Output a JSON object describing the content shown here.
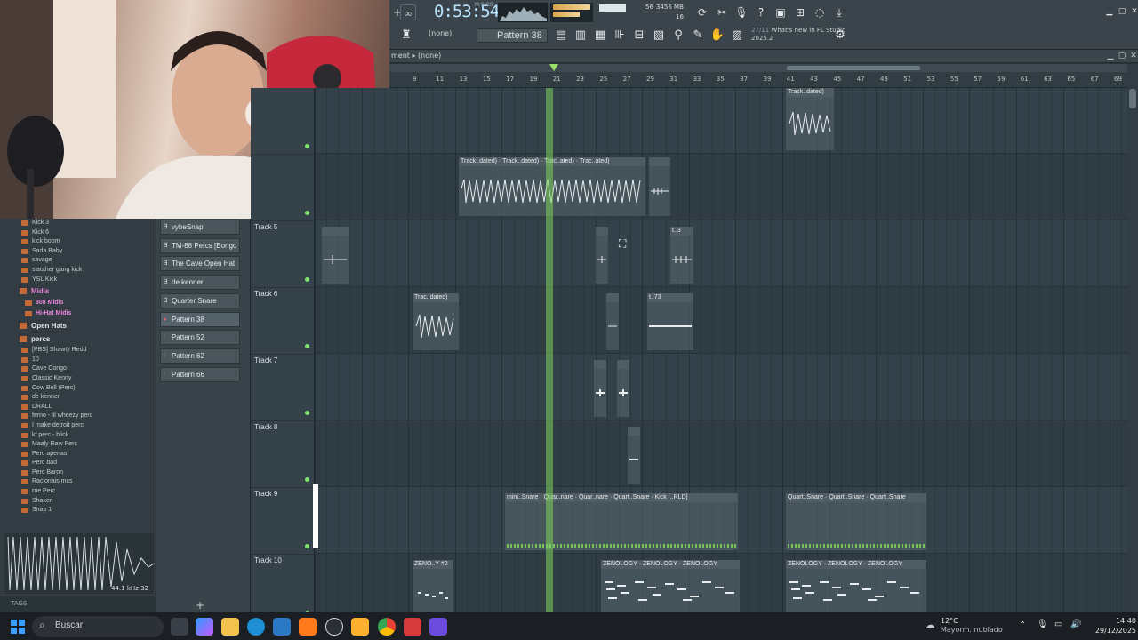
{
  "toolbar": {
    "time": "0:53:54",
    "time_unit": "M:S:CS",
    "memory_total": "3456 MB",
    "memory_value": "56",
    "polyphony": "16",
    "pattern_label": "Pattern 38",
    "none_label": "(none)",
    "news_date": "27/11",
    "news_text": "What's new in FL Studio 2025.2"
  },
  "playlist": {
    "title_prefix": "ment",
    "title_arrangement": "(none)",
    "ruler_ticks": [
      "9",
      "11",
      "13",
      "15",
      "17",
      "19",
      "21",
      "23",
      "25",
      "27",
      "29",
      "31",
      "33",
      "35",
      "37",
      "39",
      "41",
      "43",
      "45",
      "47",
      "49",
      "51",
      "53",
      "55",
      "57",
      "59",
      "61",
      "63",
      "65",
      "67",
      "69"
    ]
  },
  "browser": {
    "items_top": [
      "Kick 3",
      "Kick 6",
      "kick boom",
      "Sada Baby",
      "savage",
      "slauther gang kick",
      "YSL Kick"
    ],
    "folder_midis": "Midis",
    "sub_808": "808 Midis",
    "sub_hihat": "Hi-Hat Midis",
    "folder_open_hats": "Open Hats",
    "folder_percs": "percs",
    "items_percs": [
      "[PBS] Shawty Redd",
      "10",
      "Cave Congo",
      "Classic Kenny",
      "Cow Bell (Perc)",
      "de kenner",
      "DRALL",
      "ferno - lil wheezy perc",
      "I make detroit perc",
      "kf perc - blick",
      "Maaly Raw Perc",
      "Perc apenas",
      "Perc bad",
      "Perc Baron",
      "Racionais mcs",
      "rne Perc",
      "Shaker",
      "Snap 1"
    ],
    "sample_info": "44.1 kHz 32",
    "tags_label": "TAGS"
  },
  "patterns": [
    "vybeSnap",
    "TM-88 Percs [Bongo 1]",
    "The Cave Open Hat",
    "de kenner",
    "Quarter Snare",
    "Pattern 38",
    "Pattern 52",
    "Pattern 62",
    "Pattern 66"
  ],
  "tracks": [
    "Track 5",
    "Track 6",
    "Track 7",
    "Track 8",
    "Track 9",
    "Track 10"
  ],
  "clips": {
    "c1": "Track..dated)",
    "c2": "Track..dated)",
    "c3": "Track..dated)",
    "c4": "Trac..ated)",
    "c5": "Trac..ated)",
    "c6": "Trac..dated)",
    "c7": "t..3",
    "c8": "t..73",
    "c9": "mini..Snare",
    "c10": "Quar..nare",
    "c11": "Quar..nare",
    "c12": "Quart..Snare",
    "c13": "Kick [..RLD]",
    "c14": "Quart..Snare",
    "c15": "Quart..Snare",
    "c16": "Quart..Snare",
    "c17": "ZENO..Y #2",
    "c18": "ZENOLOGY",
    "c19": "ZENOLOGY",
    "c20": "ZENOLOGY",
    "c21": "ZENOLOGY",
    "c22": "ZENOLOGY",
    "c23": "ZENOLOGY"
  },
  "taskbar": {
    "search_placeholder": "Buscar",
    "temperature": "12°C",
    "weather": "Mayorm. nublado",
    "time": "14:40",
    "date": "29/12/2025"
  },
  "colors": {
    "playhead": "#7bd55b",
    "accent_pink": "#e880d6",
    "folder": "#c46a36"
  }
}
